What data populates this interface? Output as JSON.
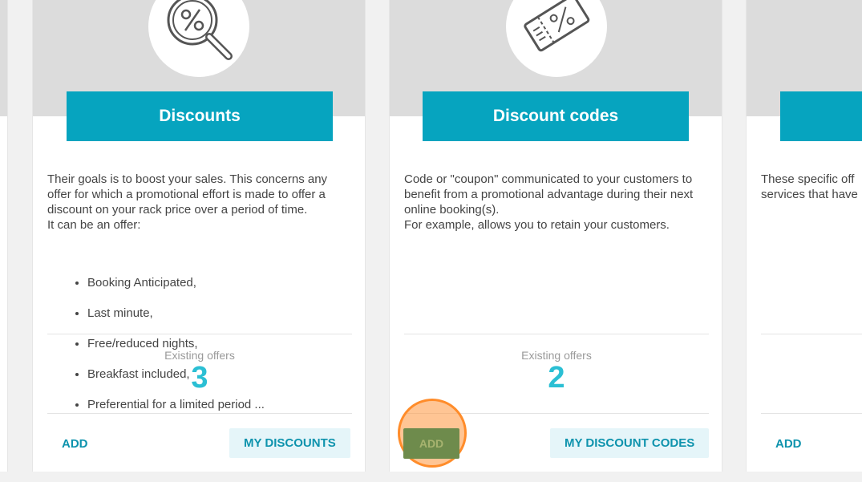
{
  "cards": [
    {
      "title": "Discounts",
      "description": "Their goals is to boost your sales. This concerns any offer for which a promotional effort is made to offer a discount on your rack price over a period of time.\nIt can be an offer:",
      "list": [
        "Booking Anticipated,",
        "Last minute,",
        "Free/reduced nights,",
        "Breakfast included,",
        "Preferential for a limited period ..."
      ],
      "offers_label": "Existing offers",
      "offers_count": "3",
      "add_label": "ADD",
      "my_label": "MY DISCOUNTS"
    },
    {
      "title": "Discount codes",
      "description": "Code or \"coupon\" communicated to your customers to benefit from a promotional advantage during their next online booking(s).\nFor example, allows you to retain your customers.",
      "offers_label": "Existing offers",
      "offers_count": "2",
      "add_label": "ADD",
      "my_label": "MY DISCOUNT CODES"
    },
    {
      "description": "These specific off\nservices that have",
      "add_label": "ADD"
    }
  ],
  "colors": {
    "accent": "#06a4bf",
    "count": "#2bbfd4",
    "link": "#0e93ad",
    "header_bg": "#dcdcdc",
    "click_highlight": "#ff8c2a"
  },
  "icons": {
    "card1": "percent-magnifier-icon",
    "card2": "discount-ticket-icon"
  }
}
